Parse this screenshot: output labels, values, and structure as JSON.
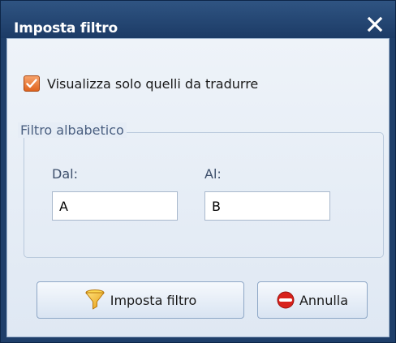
{
  "window": {
    "title": "Imposta filtro"
  },
  "checkbox": {
    "label": "Visualizza solo quelli da tradurre",
    "checked": true
  },
  "group": {
    "legend": "Filtro albabetico",
    "from_label": "Dal:",
    "from_value": "A",
    "to_label": "Al:",
    "to_value": "B"
  },
  "buttons": {
    "apply_label": "Imposta filtro",
    "cancel_label": "Annulla"
  },
  "colors": {
    "titlebar": "#1f3f6a",
    "checkbox_accent": "#e0641f",
    "cancel_icon": "#d8211b"
  },
  "icons": {
    "close": "close-icon",
    "checkmark": "checkmark-icon",
    "apply": "funnel-icon",
    "cancel": "no-entry-icon"
  }
}
